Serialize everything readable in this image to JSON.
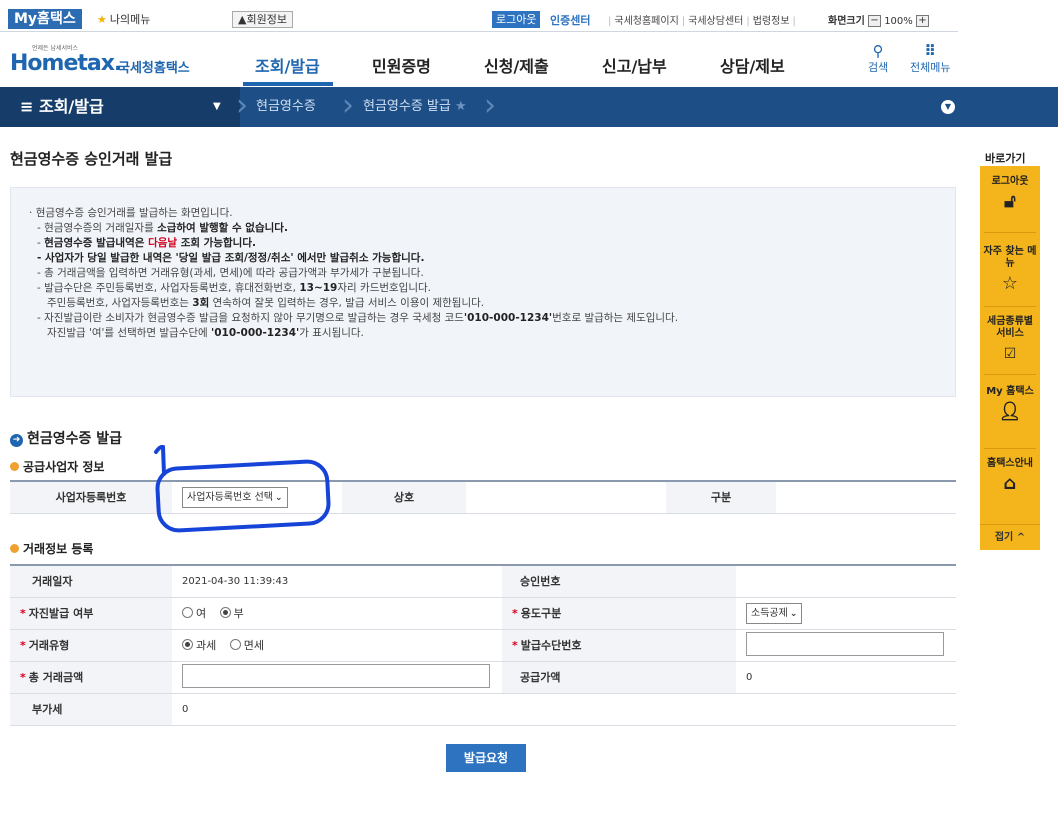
{
  "topbar": {
    "brand": "My홈택스",
    "my_menu": "나의메뉴",
    "member_info": "회원정보",
    "login": "로그아웃",
    "cert_center": "인증센터",
    "links": [
      "국세청홈페이지",
      "국세상담센터",
      "법령정보"
    ],
    "screen_size_label": "화면크기",
    "zoom": "100%"
  },
  "gnb": {
    "logo_small": "언제든 납세서비스",
    "logo_main": "Hometax.",
    "logo_kr": "국세청홈택스",
    "menus": [
      "조회/발급",
      "민원증명",
      "신청/제출",
      "신고/납부",
      "상담/제보"
    ],
    "search": "검색",
    "all_menu": "전체메뉴"
  },
  "location": {
    "root": "조회/발급",
    "crumb1": "현금영수증",
    "crumb2": "현금영수증 발급"
  },
  "page_title": "현금영수증 승인거래 발급",
  "info": {
    "line1": "현금영수증 승인거래를 발급하는 화면입니다.",
    "line2_a": "- 현금영수증의 거래일자를 ",
    "line2_b": "소급하여 발행할 수 없습니다.",
    "line3_a": "- ",
    "line3_b": "현금영수증 발급내역은 ",
    "line3_red": "다음날",
    "line3_c": " 조회 가능합니다.",
    "line4": "- 사업자가 당일 발급한 내역은 '당일 발급 조회/정정/취소' 에서만 발급취소 가능합니다.",
    "line5": "- 총 거래금액을 입력하면 거래유형(과세, 면세)에 따라 공급가액과 부가세가 구분됩니다.",
    "line6_a": "- 발급수단은 주민등록번호, 사업자등록번호, 휴대전화번호, ",
    "line6_b": "13~19",
    "line6_c": "자리 카드번호입니다.",
    "line7_a": "주민등록번호, 사업자등록번호는 ",
    "line7_b": "3회",
    "line7_c": " 연속하여 잘못 입력하는 경우, 발급 서비스 이용이 제한됩니다.",
    "line8_a": "- 자진발급이란 소비자가 현금영수증 발급을 요청하지 않아 무기명으로 발급하는 경우 국세청 코드",
    "line8_b": "'010-000-1234'",
    "line8_c": "번호로 발급하는 제도입니다.",
    "line9_a": "자진발급 '여'를 선택하면 발급수단에 ",
    "line9_b": "'010-000-1234'",
    "line9_c": "가 표시됩니다."
  },
  "section": {
    "title": "현금영수증 발급",
    "supplier_header": "공급사업자 정보",
    "trade_header": "거래정보 등록"
  },
  "supplier": {
    "bizno_label": "사업자등록번호",
    "bizno_select": "사업자등록번호 선택",
    "name_label": "상호",
    "type_label": "구분"
  },
  "trade": {
    "date_label": "거래일자",
    "date_value": "2021-04-30 11:39:43",
    "approval_label": "승인번호",
    "self_label": "자진발급 여부",
    "yes": "여",
    "no": "부",
    "usage_label": "용도구분",
    "usage_value": "소득공제",
    "type_label": "거래유형",
    "taxable": "과세",
    "exempt": "면세",
    "means_label": "발급수단번호",
    "total_label": "총 거래금액",
    "supply_label": "공급가액",
    "supply_value": "0",
    "vat_label": "부가세",
    "vat_value": "0"
  },
  "issue_button": "발급요청",
  "quick": {
    "title": "바로가기",
    "items": [
      "로그아웃",
      "자주 찾는 메뉴",
      "세금종류별 서비스",
      "My 홈택스",
      "홈택스안내"
    ],
    "close": "접기"
  },
  "annotation": {
    "number": "1",
    "color": "#1744d8"
  }
}
